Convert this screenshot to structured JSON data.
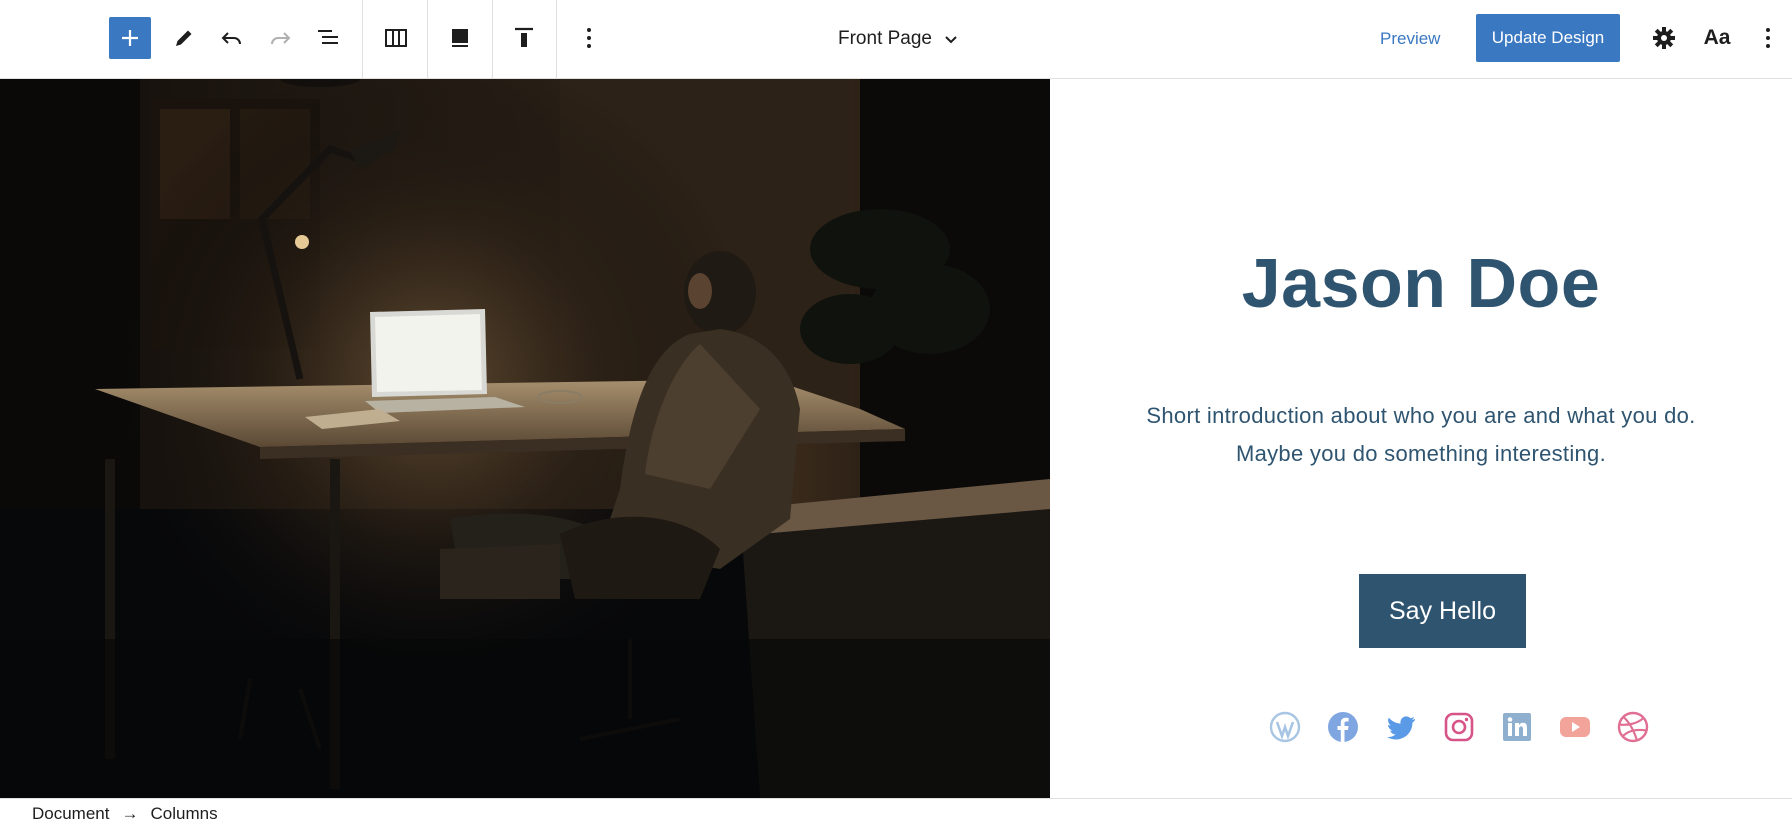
{
  "toolbar": {
    "add_icon": "plus-icon",
    "tools_icon": "pencil-icon",
    "undo_icon": "undo-icon",
    "redo_icon": "redo-icon",
    "list_view_icon": "list-view-icon",
    "columns_icon": "columns-icon",
    "block_type_icon": "cover-block-icon",
    "align_icon": "align-top-icon",
    "more_icon": "more-vertical-icon",
    "document_title": "Front Page",
    "preview_label": "Preview",
    "update_label": "Update Design",
    "settings_icon": "gear-icon",
    "styles_label": "Aa",
    "options_icon": "more-vertical-icon",
    "accent_color": "#3a78c2"
  },
  "canvas": {
    "image_alt_icon": "photo-man-at-desk",
    "name": "Jason Doe",
    "intro_line1": "Short introduction about who you are and what you do.",
    "intro_line2": "Maybe you do something interesting.",
    "button_label": "Say Hello",
    "text_color": "#2f5470",
    "socials": [
      {
        "name": "wordpress-icon",
        "color": "#a8c6e3"
      },
      {
        "name": "facebook-icon",
        "color": "#80a6e1"
      },
      {
        "name": "twitter-icon",
        "color": "#5b9ae6"
      },
      {
        "name": "instagram-icon",
        "color": "#d65487"
      },
      {
        "name": "linkedin-icon",
        "color": "#8fafcf"
      },
      {
        "name": "youtube-icon",
        "color": "#f2a49a"
      },
      {
        "name": "dribbble-icon",
        "color": "#e06f93"
      }
    ]
  },
  "footer": {
    "crumbs": [
      "Document",
      "Columns"
    ],
    "separator": "→"
  }
}
